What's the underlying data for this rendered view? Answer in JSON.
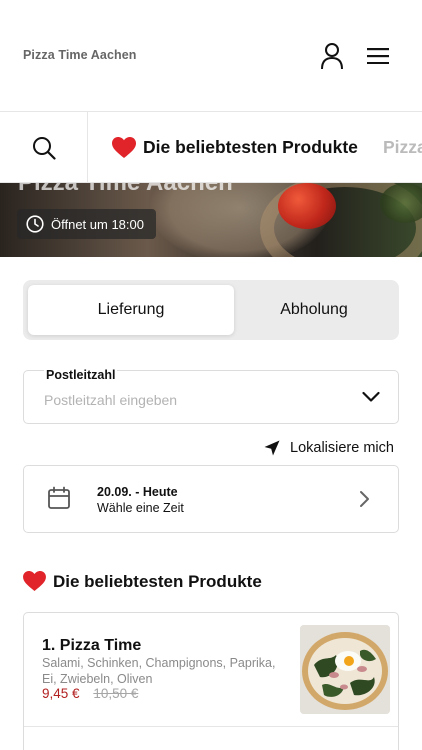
{
  "header": {
    "brand": "Pizza Time Aachen",
    "user_icon": "user-icon",
    "menu_icon": "hamburger-menu-icon"
  },
  "categories": {
    "search_icon": "search-icon",
    "items": [
      {
        "label": "Die beliebtesten Produkte",
        "icon": "heart-icon",
        "active": true
      },
      {
        "label": "Pizza"
      }
    ]
  },
  "hero": {
    "title": "Pizza Time Aachen",
    "opening": "Öffnet um 18:00",
    "clock_icon": "clock-icon"
  },
  "delivery_toggle": {
    "options": [
      "Lieferung",
      "Abholung"
    ],
    "selected": "Lieferung"
  },
  "postcode": {
    "label": "Postleitzahl",
    "placeholder": "Postleitzahl eingeben",
    "value": ""
  },
  "locate": {
    "label": "Lokalisiere mich",
    "icon": "location-arrow-icon"
  },
  "date": {
    "title": "20.09. - Heute",
    "subtitle": "Wähle eine Zeit",
    "icon": "calendar-icon"
  },
  "popular": {
    "title": "Die beliebtesten Produkte",
    "icon": "heart-icon",
    "products": [
      {
        "name": "1. Pizza Time",
        "description": "Salami, Schinken, Champignons, Paprika, Ei, Zwiebeln, Oliven",
        "price": "9,45 €",
        "old_price": "10,50 €"
      }
    ]
  },
  "colors": {
    "heart": "#e0242a",
    "price": "#b22020",
    "toggle_bg": "#ebebeb",
    "border": "#dcdcdc"
  }
}
